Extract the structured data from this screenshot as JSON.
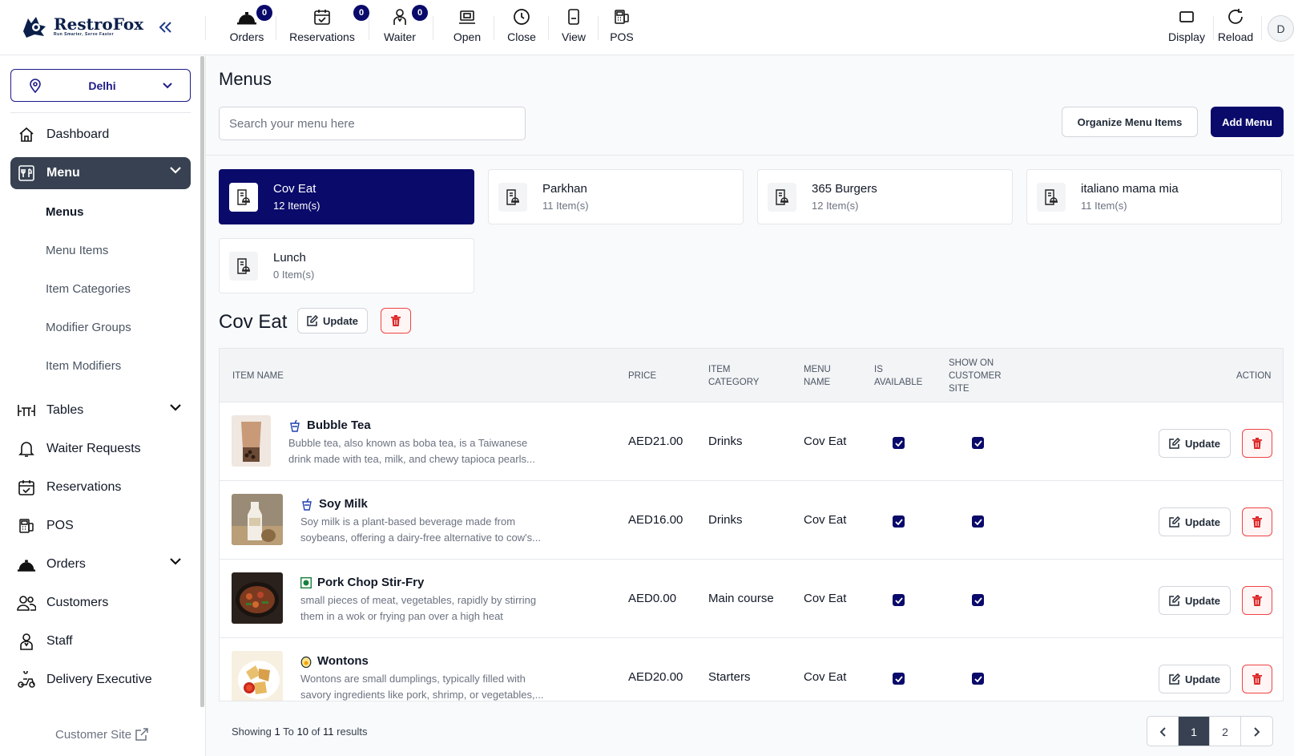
{
  "brand": {
    "name": "RestroFox",
    "tagline": "Run Smarter, Serve Faster"
  },
  "topbar": {
    "left": [
      {
        "label": "Orders",
        "icon": "bell-icon",
        "badge": "0"
      },
      {
        "label": "Reservations",
        "icon": "calendar-check-icon",
        "badge": "0"
      },
      {
        "label": "Waiter",
        "icon": "waiter-icon",
        "badge": "0"
      },
      {
        "label": "Open",
        "icon": "register-icon"
      },
      {
        "label": "Close",
        "icon": "clock-icon"
      },
      {
        "label": "View",
        "icon": "receipt-icon"
      },
      {
        "label": "POS",
        "icon": "pos-icon"
      }
    ],
    "right": [
      {
        "label": "Display",
        "icon": "monitor-icon"
      },
      {
        "label": "Reload",
        "icon": "reload-icon"
      }
    ],
    "avatar": "D"
  },
  "sidebar": {
    "location": "Delhi",
    "items": [
      {
        "label": "Dashboard",
        "icon": "home-icon"
      },
      {
        "label": "Menu",
        "icon": "menu-book-icon",
        "active": true
      },
      {
        "label": "Tables",
        "icon": "table-icon"
      },
      {
        "label": "Waiter Requests",
        "icon": "bell-outline-icon"
      },
      {
        "label": "Reservations",
        "icon": "calendar-check-icon"
      },
      {
        "label": "POS",
        "icon": "pos-icon"
      },
      {
        "label": "Orders",
        "icon": "cloche-icon"
      },
      {
        "label": "Customers",
        "icon": "users-icon"
      },
      {
        "label": "Staff",
        "icon": "staff-icon"
      },
      {
        "label": "Delivery Executive",
        "icon": "scooter-icon"
      }
    ],
    "submenu": [
      {
        "label": "Menus",
        "active": true
      },
      {
        "label": "Menu Items"
      },
      {
        "label": "Item Categories"
      },
      {
        "label": "Modifier Groups"
      },
      {
        "label": "Item Modifiers"
      }
    ],
    "customer_site": "Customer Site"
  },
  "page": {
    "title": "Menus",
    "search_placeholder": "Search your menu here",
    "organize_label": "Organize Menu Items",
    "add_label": "Add Menu"
  },
  "menus": [
    {
      "name": "Cov Eat",
      "count": "12 Item(s)",
      "active": true
    },
    {
      "name": "Parkhan",
      "count": "11 Item(s)"
    },
    {
      "name": "365 Burgers",
      "count": "12 Item(s)"
    },
    {
      "name": "italiano mama mia",
      "count": "11 Item(s)"
    },
    {
      "name": "Lunch",
      "count": "0 Item(s)"
    }
  ],
  "selected_menu": {
    "title": "Cov Eat",
    "update_label": "Update"
  },
  "table": {
    "headers": {
      "item_name": "ITEM NAME",
      "price": "PRICE",
      "category": [
        "ITEM",
        "CATEGORY"
      ],
      "menu_name": [
        "MENU",
        "NAME"
      ],
      "available": [
        "IS",
        "AVAILABLE"
      ],
      "show_site": [
        "SHOW ON",
        "CUSTOMER",
        "SITE"
      ],
      "action": "ACTION"
    },
    "rows": [
      {
        "name": "Bubble Tea",
        "type": "drink",
        "type_icon": "drink-icon",
        "desc1": "Bubble tea, also known as boba tea, is a Taiwanese",
        "desc2": "drink made with tea, milk, and chewy tapioca pearls...",
        "price": "AED21.00",
        "category": "Drinks",
        "menu": "Cov Eat",
        "available": true,
        "show": true,
        "thumb_colors": [
          "#c89a78",
          "#6b4a36"
        ]
      },
      {
        "name": "Soy Milk",
        "type": "drink",
        "type_icon": "drink-icon",
        "desc1": "Soy milk is a plant-based beverage made from",
        "desc2": "soybeans, offering a dairy-free alternative to cow's...",
        "price": "AED16.00",
        "category": "Drinks",
        "menu": "Cov Eat",
        "available": true,
        "show": true,
        "thumb_colors": [
          "#e8e2d6",
          "#b99e78"
        ]
      },
      {
        "name": "Pork Chop Stir-Fry",
        "type": "veg",
        "type_icon": "veg-dot-icon",
        "desc1": "small pieces of meat, vegetables, rapidly by stirring",
        "desc2": "them in a wok or frying pan over a high heat",
        "price": "AED0.00",
        "category": "Main course",
        "menu": "Cov Eat",
        "available": true,
        "show": true,
        "thumb_colors": [
          "#3a2a22",
          "#b8452a"
        ]
      },
      {
        "name": "Wontons",
        "type": "egg",
        "type_icon": "egg-icon",
        "desc1": "Wontons are small dumplings, typically filled with",
        "desc2": "savory ingredients like pork, shrimp, or vegetables,...",
        "price": "AED20.00",
        "category": "Starters",
        "menu": "Cov Eat",
        "available": true,
        "show": true,
        "thumb_colors": [
          "#f2e0b0",
          "#d8a04a"
        ]
      }
    ],
    "row_update_label": "Update",
    "showing": {
      "prefix": "Showing",
      "from": "1",
      "to_word": "To",
      "to": "10",
      "of_word": "of",
      "total": "11",
      "suffix": "results"
    },
    "pages": [
      "1",
      "2"
    ]
  },
  "colors": {
    "primary": "#0a0a6b",
    "sidebar_active": "#374151",
    "danger": "#ef4444"
  }
}
